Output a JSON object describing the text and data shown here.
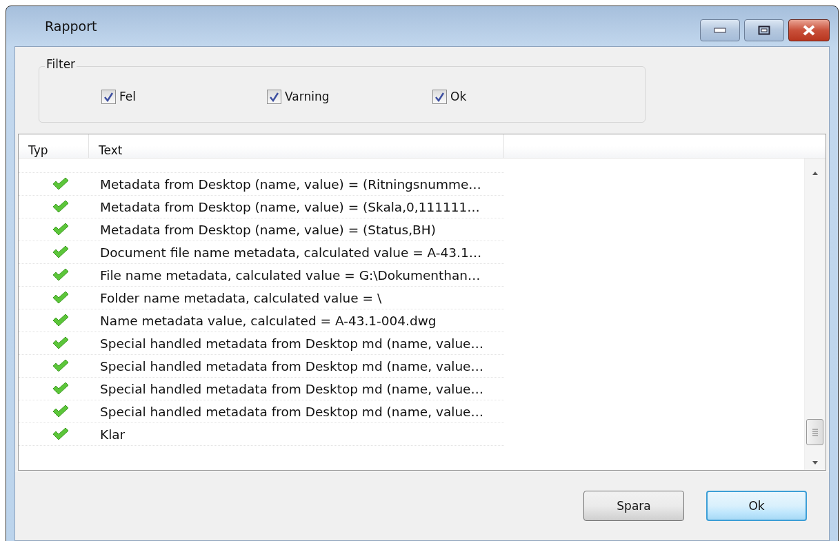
{
  "window": {
    "title": "Rapport"
  },
  "filter": {
    "label": "Filter",
    "options": [
      {
        "label": "Fel",
        "checked": true
      },
      {
        "label": "Varning",
        "checked": true
      },
      {
        "label": "Ok",
        "checked": true
      }
    ]
  },
  "table": {
    "columns": [
      "Typ",
      "Text"
    ],
    "rows": [
      {
        "text": "Metadata from Desktop (name, value) = (Ritningsnumme…"
      },
      {
        "text": "Metadata from Desktop (name, value) = (Skala,0,111111…"
      },
      {
        "text": "Metadata from Desktop (name, value) = (Status,BH)"
      },
      {
        "text": "Document file name metadata, calculated value = A-43.1…"
      },
      {
        "text": "File name metadata, calculated value = G:\\Dokumenthan…"
      },
      {
        "text": "Folder name metadata, calculated value = \\"
      },
      {
        "text": "Name metadata value, calculated = A-43.1-004.dwg"
      },
      {
        "text": "Special handled metadata from Desktop md (name, value…"
      },
      {
        "text": "Special handled metadata from Desktop md (name, value…"
      },
      {
        "text": "Special handled metadata from Desktop md (name, value…"
      },
      {
        "text": "Special handled metadata from Desktop md (name, value…"
      },
      {
        "text": "Klar"
      }
    ]
  },
  "buttons": [
    {
      "label": "Spara",
      "focused": false
    },
    {
      "label": "Ok",
      "focused": true
    }
  ]
}
